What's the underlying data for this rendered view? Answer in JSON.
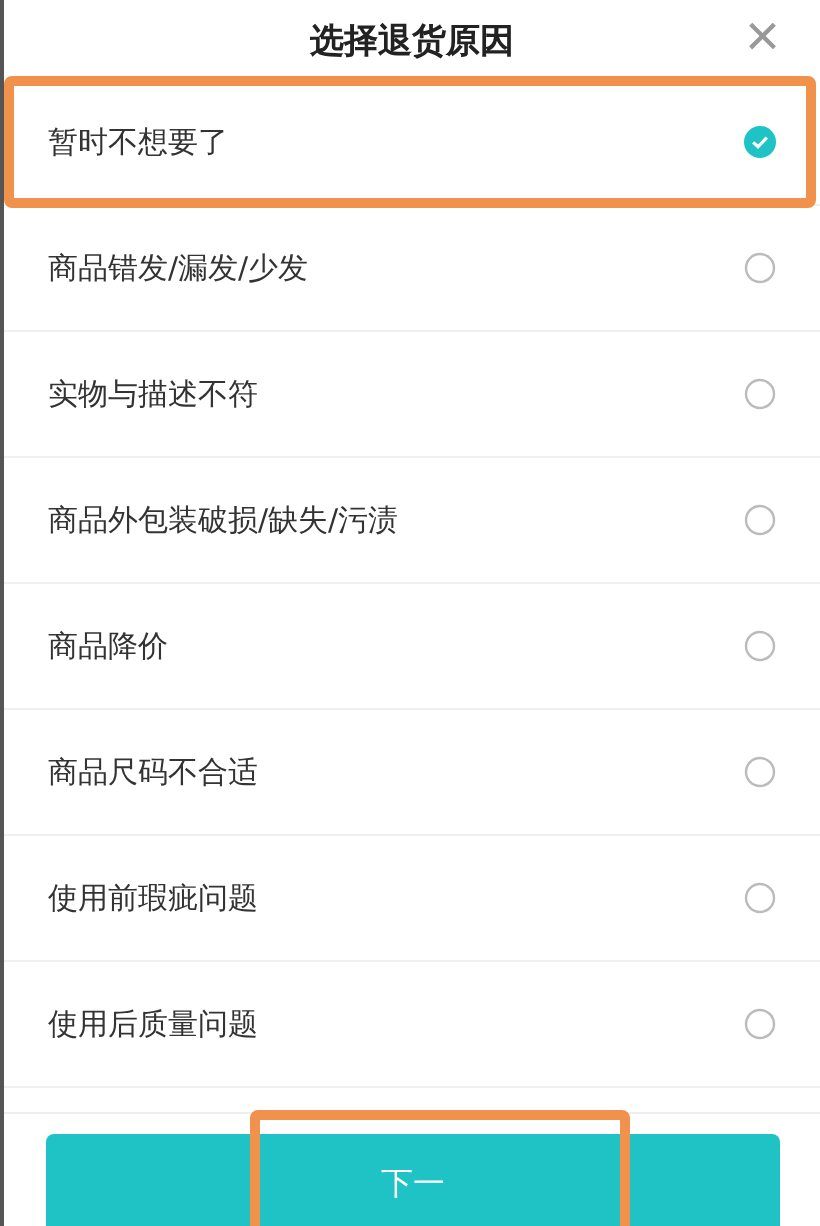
{
  "dialog": {
    "title": "选择退货原因",
    "close": "×"
  },
  "reasons": [
    {
      "label": "暂时不想要了",
      "selected": true,
      "highlighted": true
    },
    {
      "label": "商品错发/漏发/少发",
      "selected": false,
      "highlighted": false
    },
    {
      "label": "实物与描述不符",
      "selected": false,
      "highlighted": false
    },
    {
      "label": "商品外包装破损/缺失/污渍",
      "selected": false,
      "highlighted": false
    },
    {
      "label": "商品降价",
      "selected": false,
      "highlighted": false
    },
    {
      "label": "商品尺码不合适",
      "selected": false,
      "highlighted": false
    },
    {
      "label": "使用前瑕疵问题",
      "selected": false,
      "highlighted": false
    },
    {
      "label": "使用后质量问题",
      "selected": false,
      "highlighted": false
    }
  ],
  "next_button": {
    "label": "下一",
    "highlighted": true
  }
}
